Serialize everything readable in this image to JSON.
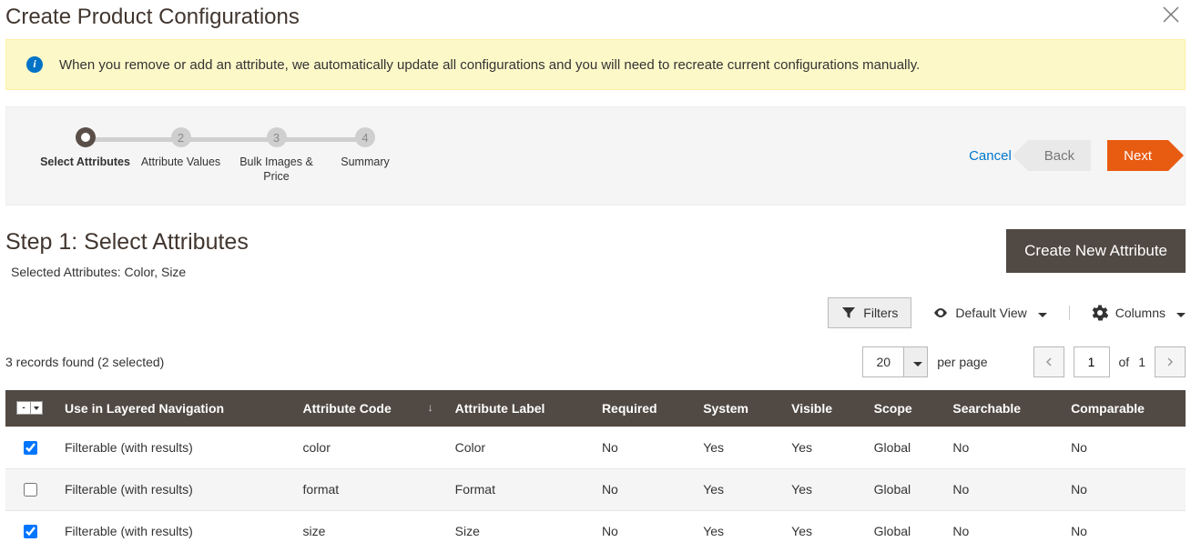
{
  "modal": {
    "title": "Create Product Configurations",
    "notice": "When you remove or add an attribute, we automatically update all configurations and you will need to recreate current configurations manually."
  },
  "wizard": {
    "steps": [
      "Select Attributes",
      "Attribute Values",
      "Bulk Images & Price",
      "Summary"
    ],
    "numbers": [
      "",
      "2",
      "3",
      "4"
    ],
    "cancel": "Cancel",
    "back": "Back",
    "next": "Next"
  },
  "step": {
    "title": "Step 1: Select Attributes",
    "selected_label": "Selected Attributes: Color, Size",
    "create_btn": "Create New Attribute"
  },
  "toolbar": {
    "filters": "Filters",
    "default_view": "Default View",
    "columns": "Columns"
  },
  "pager": {
    "records": "3 records found (2 selected)",
    "page_size": "20",
    "per_page": "per page",
    "page": "1",
    "of": "of",
    "total": "1"
  },
  "table": {
    "headers": {
      "nav": "Use in Layered Navigation",
      "code": "Attribute Code",
      "label": "Attribute Label",
      "required": "Required",
      "system": "System",
      "visible": "Visible",
      "scope": "Scope",
      "searchable": "Searchable",
      "comparable": "Comparable"
    },
    "rows": [
      {
        "checked": true,
        "nav": "Filterable (with results)",
        "code": "color",
        "label": "Color",
        "required": "No",
        "system": "Yes",
        "visible": "Yes",
        "scope": "Global",
        "searchable": "No",
        "comparable": "No"
      },
      {
        "checked": false,
        "nav": "Filterable (with results)",
        "code": "format",
        "label": "Format",
        "required": "No",
        "system": "Yes",
        "visible": "Yes",
        "scope": "Global",
        "searchable": "No",
        "comparable": "No"
      },
      {
        "checked": true,
        "nav": "Filterable (with results)",
        "code": "size",
        "label": "Size",
        "required": "No",
        "system": "Yes",
        "visible": "Yes",
        "scope": "Global",
        "searchable": "No",
        "comparable": "No"
      }
    ],
    "header_select_mark": "-"
  }
}
